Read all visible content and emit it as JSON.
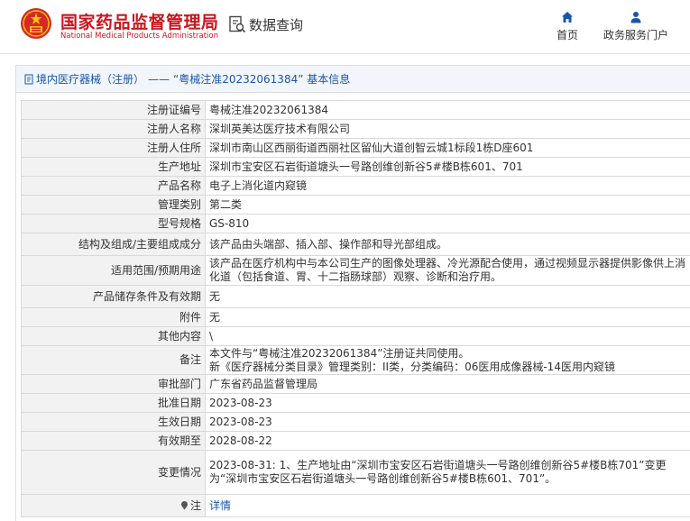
{
  "header": {
    "org_cn": "国家药品监督管理局",
    "org_en": "National Medical Products Administration",
    "query_label": "数据查询",
    "nav": [
      {
        "label": "首页",
        "icon": "home-icon"
      },
      {
        "label": "政务服务门户",
        "icon": "user-icon"
      }
    ]
  },
  "breadcrumb": {
    "category": "境内医疗器械（注册）",
    "separator": "——",
    "title": "“粤械注准20232061384” 基本信息"
  },
  "fields": [
    {
      "key": "注册证编号",
      "value": "粤械注准20232061384"
    },
    {
      "key": "注册人名称",
      "value": "深圳英美达医疗技术有限公司"
    },
    {
      "key": "注册人住所",
      "value": "深圳市南山区西丽街道西丽社区留仙大道创智云城1标段1栋D座601"
    },
    {
      "key": "生产地址",
      "value": "深圳市宝安区石岩街道塘头一号路创维创新谷5#楼B栋601、701"
    },
    {
      "key": "产品名称",
      "value": "电子上消化道内窥镜"
    },
    {
      "key": "管理类别",
      "value": "第二类"
    },
    {
      "key": "型号规格",
      "value": "GS-810"
    },
    {
      "key": "结构及组成/主要组成成分",
      "value": "该产品由头端部、插入部、操作部和导光部组成。"
    },
    {
      "key": "适用范围/预期用途",
      "value": "该产品在医疗机构中与本公司生产的图像处理器、冷光源配合使用，通过视频显示器提供影像供上消化道（包括食道、胃、十二指肠球部）观察、诊断和治疗用。"
    },
    {
      "key": "产品储存条件及有效期",
      "value": "无"
    },
    {
      "key": "附件",
      "value": "无"
    },
    {
      "key": "其他内容",
      "value": "\\"
    },
    {
      "key": "备注",
      "value": "本文件与“粤械注准20232061384”注册证共同使用。\n新《医疗器械分类目录》管理类别：II类，分类编码：06医用成像器械-14医用内窥镜"
    },
    {
      "key": "审批部门",
      "value": "广东省药品监督管理局"
    },
    {
      "key": "批准日期",
      "value": "2023-08-23"
    },
    {
      "key": "生效日期",
      "value": "2023-08-23"
    },
    {
      "key": "有效期至",
      "value": "2028-08-22"
    },
    {
      "key": "变更情况",
      "value": "2023-08-31: 1、生产地址由“深圳市宝安区石岩街道塘头一号路创维创新谷5#楼B栋701”变更为“深圳市宝安区石岩街道塘头一号路创维创新谷5#楼B栋601、701”。"
    }
  ],
  "footer_row": {
    "label": "注",
    "link": "详情",
    "icon": "pin-icon"
  },
  "colors": {
    "brand_red": "#c8161d",
    "link_blue": "#1a56a8",
    "key_bg": "#f2f2f2",
    "title_bg": "#f2f6fb"
  }
}
